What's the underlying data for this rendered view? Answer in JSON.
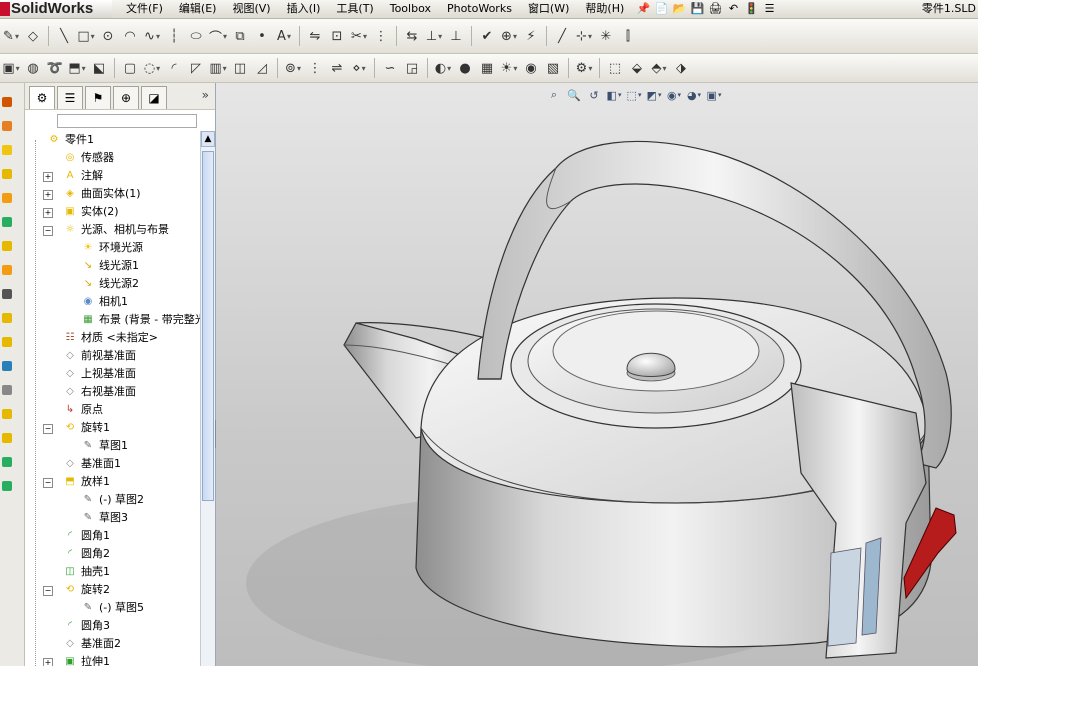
{
  "app": {
    "brand": "SolidWorks",
    "document_title": "零件1.SLD"
  },
  "menu": [
    "文件(F)",
    "编辑(E)",
    "视图(V)",
    "插入(I)",
    "工具(T)",
    "Toolbox",
    "PhotoWorks",
    "窗口(W)",
    "帮助(H)"
  ],
  "toolbar_row1_icons": [
    "sketch-icon",
    "smart-dimension-icon",
    "line-icon",
    "rectangle-icon",
    "circle-icon",
    "arc-icon",
    "spline-icon",
    "centerline-icon",
    "ellipse-icon",
    "fillet-sketch-icon",
    "offset-icon",
    "point-icon",
    "text-icon",
    "mirror-icon",
    "convert-entities-icon",
    "trim-icon",
    "linear-pattern-icon",
    "move-entities-icon",
    "display-delete-relations-icon",
    "add-relation-icon",
    "repair-sketch-icon",
    "quick-snaps-icon",
    "rapid-sketch-icon",
    "axis-icon",
    "coordinate-system-icon",
    "point-ref-icon",
    "measure-icon"
  ],
  "toolbar_row2_icons": [
    "extruded-boss-icon",
    "revolved-boss-icon",
    "swept-boss-icon",
    "lofted-boss-icon",
    "boundary-boss-icon",
    "extruded-cut-icon",
    "revolved-cut-icon",
    "fillet-icon",
    "chamfer-icon",
    "rib-icon",
    "shell-icon",
    "draft-icon",
    "hole-wizard-icon",
    "linear-pattern-icon",
    "mirror-feature-icon",
    "reference-geometry-icon",
    "curves-icon",
    "instant3d-icon",
    "render-icon",
    "appearance-icon",
    "scene-icon",
    "lights-icon",
    "camera-icon",
    "decals-icon",
    "options-icon",
    "view-orientation-icon",
    "isometric-icon",
    "trimetric-icon",
    "dimetric-icon"
  ],
  "panel": {
    "tabs": [
      "featuremanager-icon",
      "propertymanager-icon",
      "configuration-icon",
      "dimxpert-icon",
      "display-manager-icon"
    ],
    "more": "»",
    "tree": [
      {
        "label": "零件1",
        "level": 0,
        "icon": "part-icon",
        "expander": "",
        "color": "#e6b800"
      },
      {
        "label": "传感器",
        "level": 1,
        "icon": "sensor-icon",
        "expander": "",
        "color": "#e6b800"
      },
      {
        "label": "注解",
        "level": 1,
        "icon": "annotation-icon",
        "expander": "+",
        "color": "#e6b800"
      },
      {
        "label": "曲面实体(1)",
        "level": 1,
        "icon": "surface-bodies-icon",
        "expander": "+",
        "color": "#e6b800"
      },
      {
        "label": "实体(2)",
        "level": 1,
        "icon": "solid-bodies-icon",
        "expander": "+",
        "color": "#e6b800"
      },
      {
        "label": "光源、相机与布景",
        "level": 1,
        "icon": "lights-cameras-scene-icon",
        "expander": "−",
        "color": "#e6b800"
      },
      {
        "label": "环境光源",
        "level": 2,
        "icon": "ambient-light-icon",
        "expander": "",
        "color": "#f2c200"
      },
      {
        "label": "线光源1",
        "level": 2,
        "icon": "directional-light-icon",
        "expander": "",
        "color": "#d9a400"
      },
      {
        "label": "线光源2",
        "level": 2,
        "icon": "directional-light-icon",
        "expander": "",
        "color": "#d9a400"
      },
      {
        "label": "相机1",
        "level": 2,
        "icon": "camera-icon",
        "expander": "",
        "color": "#5b87c8"
      },
      {
        "label": "布景 (背景 - 带完整光",
        "level": 2,
        "icon": "scene-icon",
        "expander": "",
        "color": "#3a9a3a"
      },
      {
        "label": "材质 <未指定>",
        "level": 1,
        "icon": "material-icon",
        "expander": "",
        "color": "#a0522d"
      },
      {
        "label": "前视基准面",
        "level": 1,
        "icon": "plane-icon",
        "expander": "",
        "color": "#888888"
      },
      {
        "label": "上视基准面",
        "level": 1,
        "icon": "plane-icon",
        "expander": "",
        "color": "#888888"
      },
      {
        "label": "右视基准面",
        "level": 1,
        "icon": "plane-icon",
        "expander": "",
        "color": "#888888"
      },
      {
        "label": "原点",
        "level": 1,
        "icon": "origin-icon",
        "expander": "",
        "color": "#c0392b"
      },
      {
        "label": "旋转1",
        "level": 1,
        "icon": "revolve-icon",
        "expander": "−",
        "color": "#e6b800"
      },
      {
        "label": "草图1",
        "level": 2,
        "icon": "sketch-icon",
        "expander": "",
        "color": "#666666"
      },
      {
        "label": "基准面1",
        "level": 1,
        "icon": "plane-icon",
        "expander": "",
        "color": "#888888"
      },
      {
        "label": "放样1",
        "level": 1,
        "icon": "loft-icon",
        "expander": "−",
        "color": "#e6b800"
      },
      {
        "label": "(-) 草图2",
        "level": 2,
        "icon": "sketch-icon",
        "expander": "",
        "color": "#666666"
      },
      {
        "label": "草图3",
        "level": 2,
        "icon": "sketch-icon",
        "expander": "",
        "color": "#666666"
      },
      {
        "label": "圆角1",
        "level": 1,
        "icon": "fillet-icon",
        "expander": "",
        "color": "#2e9e2e"
      },
      {
        "label": "圆角2",
        "level": 1,
        "icon": "fillet-icon",
        "expander": "",
        "color": "#2e9e2e"
      },
      {
        "label": "抽壳1",
        "level": 1,
        "icon": "shell-icon",
        "expander": "",
        "color": "#2e9e2e"
      },
      {
        "label": "旋转2",
        "level": 1,
        "icon": "revolve-icon",
        "expander": "−",
        "color": "#e6b800"
      },
      {
        "label": "(-) 草图5",
        "level": 2,
        "icon": "sketch-icon",
        "expander": "",
        "color": "#666666"
      },
      {
        "label": "圆角3",
        "level": 1,
        "icon": "fillet-icon",
        "expander": "",
        "color": "#2e9e2e"
      },
      {
        "label": "基准面2",
        "level": 1,
        "icon": "plane-icon",
        "expander": "",
        "color": "#888888"
      },
      {
        "label": "拉伸1",
        "level": 1,
        "icon": "extrude-icon",
        "expander": "+",
        "color": "#2e9e2e"
      }
    ]
  },
  "viewport_hud_icons": [
    "zoom-to-fit-icon",
    "zoom-area-icon",
    "previous-view-icon",
    "section-view-icon",
    "view-orientation-icon",
    "display-style-icon",
    "hide-show-items-icon",
    "edit-appearance-icon",
    "apply-scene-icon"
  ],
  "colors": {
    "accent_red": "#c8102e",
    "viewport_bg": "#d4d4d4",
    "switch_red": "#b71c1c"
  }
}
